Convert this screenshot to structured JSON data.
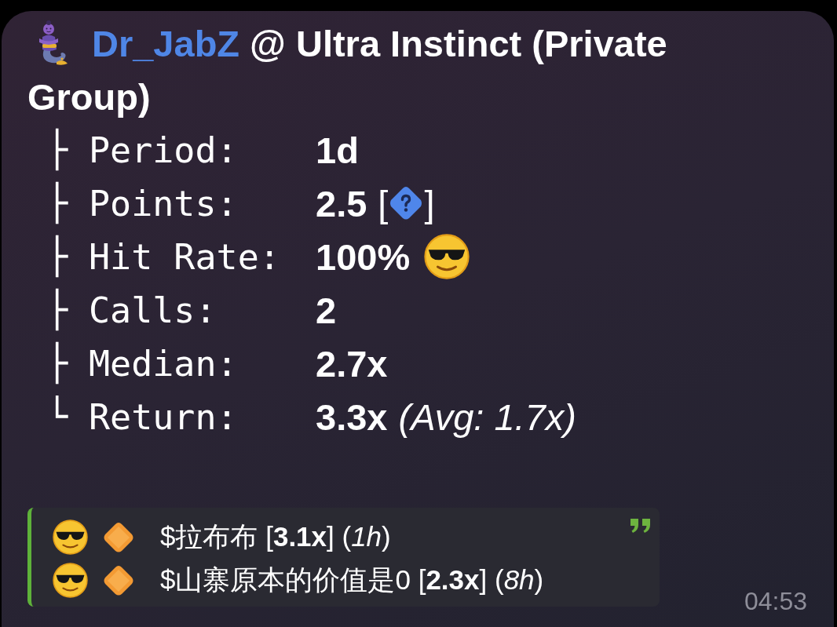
{
  "header": {
    "author": "Dr_JabZ",
    "title_lines": [
      "@ Ultra Instinct (Private",
      "Group)"
    ]
  },
  "stats": [
    {
      "kind": "text",
      "branch": "├",
      "label": "Period:",
      "value": "1d"
    },
    {
      "kind": "help",
      "branch": "├",
      "label": "Points:",
      "value": "2.5",
      "open": "[",
      "close": "]"
    },
    {
      "kind": "emoji",
      "branch": "├",
      "label": "Hit Rate:",
      "value": "100%"
    },
    {
      "kind": "text",
      "branch": "├",
      "label": "Calls:",
      "value": "2"
    },
    {
      "kind": "text",
      "branch": "├",
      "label": "Median:",
      "value": "2.7x"
    },
    {
      "kind": "note",
      "branch": "└",
      "label": "Return:",
      "value": "3.3x",
      "note": "(Avg: 1.7x)"
    }
  ],
  "quote": {
    "lines": [
      {
        "text": "$拉布布 [**3.1x**] (*1h*)"
      },
      {
        "text": "$山寨原本的价值是0 [**2.3x**] (*8h*)"
      }
    ]
  },
  "time": "04:53"
}
